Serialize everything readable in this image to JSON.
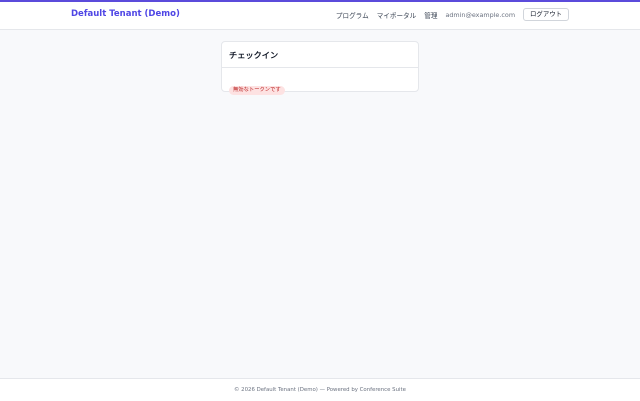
{
  "header": {
    "brand": "Default Tenant (Demo)",
    "nav": {
      "program": "プログラム",
      "my_portal": "マイポータル",
      "admin": "管理"
    },
    "user_email": "admin@example.com",
    "logout_label": "ログアウト"
  },
  "card": {
    "title": "チェックイン",
    "status_badge": "無効なトークンです"
  },
  "footer": {
    "text": "© 2026 Default Tenant (Demo) — Powered by Conference Suite"
  },
  "colors": {
    "accent": "#4f46e5",
    "error_badge_bg": "#fde2e2",
    "error_badge_text": "#b91c1c"
  }
}
